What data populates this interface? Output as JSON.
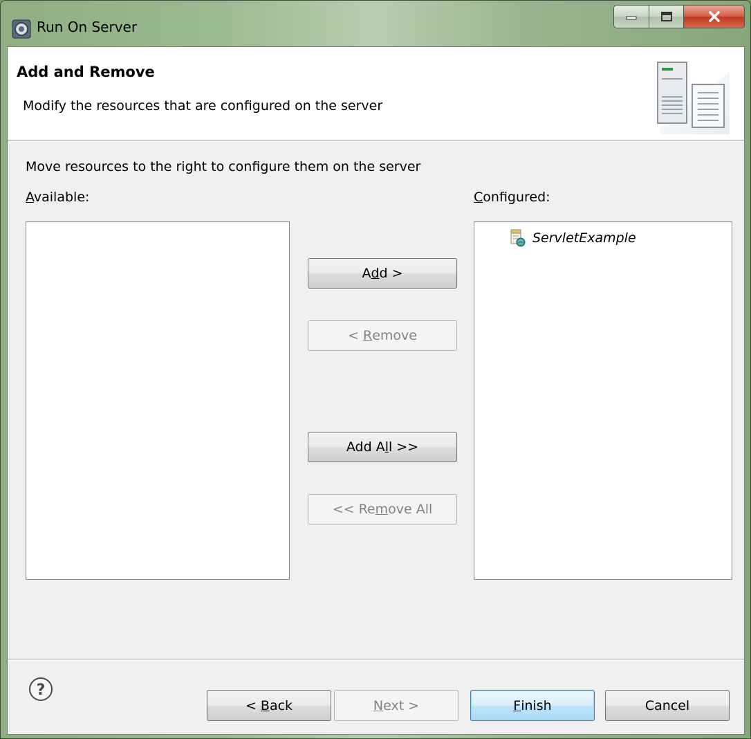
{
  "window": {
    "title": "Run On Server"
  },
  "header": {
    "title": "Add and Remove",
    "description": "Modify the resources that are configured on the server"
  },
  "body": {
    "instruction": "Move resources to the right to configure them on the server",
    "available_label_first": "A",
    "available_label_rest": "vailable:",
    "configured_label_first": "C",
    "configured_label_rest": "onfigured:",
    "available_items": [],
    "configured_items": [
      {
        "label": "ServletExample",
        "icon": "web-project-icon"
      }
    ]
  },
  "buttons": {
    "add": {
      "pre": "A",
      "mn": "d",
      "post": "d >",
      "enabled": true
    },
    "remove": {
      "pre": "< ",
      "mn": "R",
      "post": "emove",
      "enabled": false
    },
    "add_all": {
      "pre": "Add A",
      "mn": "l",
      "post": "l >>",
      "enabled": true
    },
    "remove_all": {
      "pre": "<< Re",
      "mn": "m",
      "post": "ove All",
      "enabled": false
    }
  },
  "footer": {
    "back": {
      "pre": "< ",
      "mn": "B",
      "post": "ack",
      "enabled": true
    },
    "next": {
      "pre": "",
      "mn": "N",
      "post": "ext >",
      "enabled": false
    },
    "finish": {
      "pre": "",
      "mn": "F",
      "post": "inish",
      "enabled": true
    },
    "cancel": {
      "label": "Cancel",
      "enabled": true
    }
  },
  "icons": {
    "title": "server-gear-icon",
    "banner": "server-wizard-icon",
    "help": "help-icon",
    "minimize": "minimize-icon",
    "maximize": "maximize-icon",
    "close": "close-icon"
  },
  "colors": {
    "title_bar": "#9dbb92",
    "client_bg": "#f0f0f0",
    "default_button_border": "#3c7fb1",
    "close_button": "#c0361f"
  }
}
